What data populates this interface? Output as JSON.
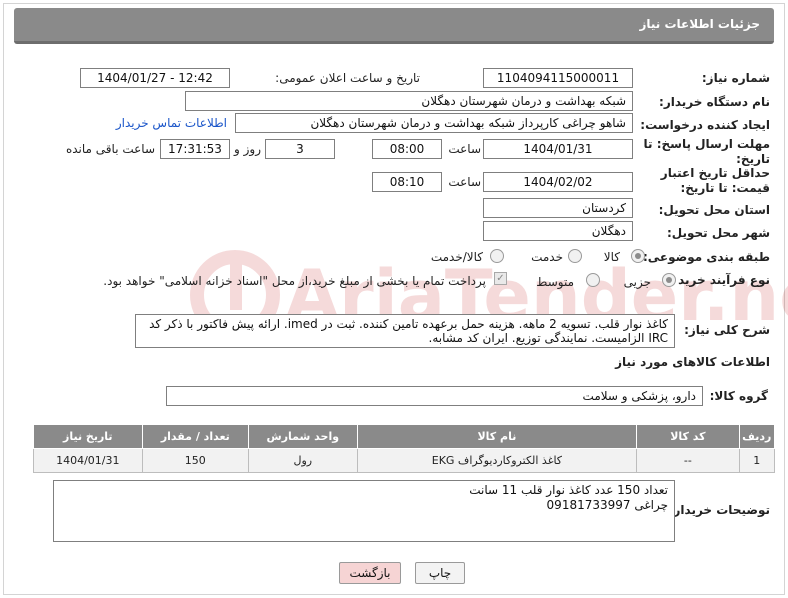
{
  "page": {
    "title": "جزئیات اطلاعات نیاز"
  },
  "fields": {
    "need_number_label": "شماره نیاز:",
    "need_number": "1104094115000011",
    "announce_label": "تاریخ و ساعت اعلان عمومی:",
    "announce_value": "1404/01/27 - 12:42",
    "buyer_org_label": "نام دستگاه خریدار:",
    "buyer_org": "شبکه بهداشت و درمان شهرستان دهگلان",
    "creator_label": "ایجاد کننده درخواست:",
    "creator": "شاهو چراغی کارپرداز شبکه بهداشت و درمان شهرستان دهگلان",
    "contact_link": "اطلاعات تماس خریدار",
    "reply_deadline_label": "مهلت ارسال پاسخ: تا تاریخ:",
    "reply_date": "1404/01/31",
    "time_word": "ساعت",
    "reply_time": "08:00",
    "days_value": "3",
    "days_and": "روز و",
    "remaining_time": "17:31:53",
    "remaining_label": "ساعت باقی مانده",
    "price_validity_label": "حداقل تاریخ اعتبار قیمت: تا تاریخ:",
    "price_date": "1404/02/02",
    "price_time": "08:10",
    "province_label": "استان محل تحویل:",
    "province": "کردستان",
    "city_label": "شهر محل تحویل:",
    "city": "دهگلان",
    "category_label": "طبقه بندی موضوعی:",
    "category_options": [
      "کالا",
      "خدمت",
      "کالا/خدمت"
    ],
    "process_label": "نوع فرآیند خرید :",
    "process_options": [
      "جزیی",
      "متوسط"
    ],
    "payment_text": "پرداخت تمام یا بخشی از مبلغ خرید،از محل \"اسناد خزانه اسلامی\" خواهد بود.",
    "description_label": "شرح کلی نیاز:",
    "description": "کاغذ نوار قلب. تسویه 2 ماهه. هزینه حمل برعهده تامین کننده. ثبت در imed. ارائه پیش فاکتور با ذکر کد IRC الزامیست. نمایندگی توزیع. ایران کد مشابه.",
    "goods_info_title": "اطلاعات کالاهای مورد نیاز",
    "goods_group_label": "گروه کالا:",
    "goods_group": "دارو، پزشکی و سلامت",
    "buyer_notes_label": "توضیحات خریدار:",
    "buyer_notes": "تعداد 150 عدد کاغذ نوار قلب 11 سانت\nچراغی 09181733997"
  },
  "table": {
    "headers": [
      "ردیف",
      "کد کالا",
      "نام کالا",
      "واحد شمارش",
      "تعداد / مقدار",
      "تاریخ نیاز"
    ],
    "rows": [
      [
        "1",
        "--",
        "کاغذ الکتروکاردیوگراف EKG",
        "رول",
        "150",
        "1404/01/31"
      ]
    ]
  },
  "buttons": {
    "print": "چاپ",
    "back": "بازگشت"
  },
  "colors": {
    "header_bg": "#8a8a8a",
    "link": "#1a55c9",
    "back_button": "#f6d4d4"
  }
}
